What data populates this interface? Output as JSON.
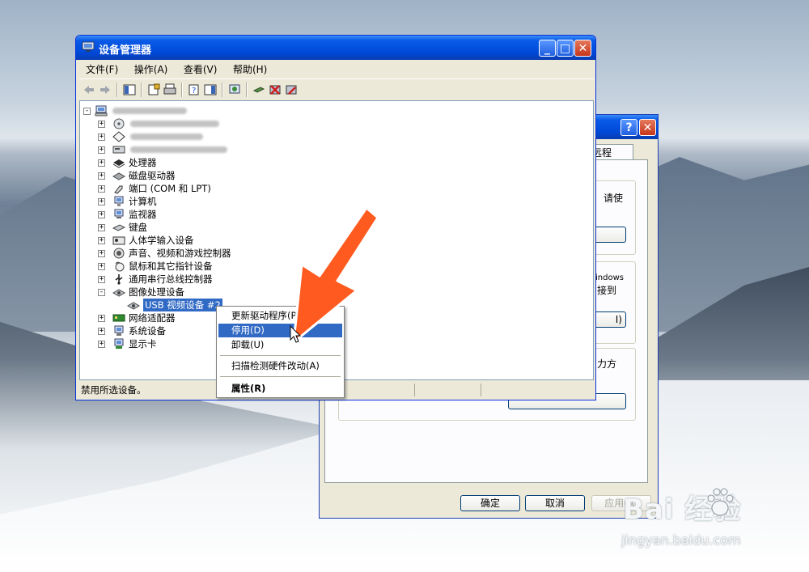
{
  "device_manager": {
    "title": "设备管理器",
    "menu": [
      {
        "label": "文件(F)"
      },
      {
        "label": "操作(A)"
      },
      {
        "label": "查看(V)"
      },
      {
        "label": "帮助(H)"
      }
    ],
    "tree": {
      "categories": [
        {
          "label": "处理器"
        },
        {
          "label": "磁盘驱动器"
        },
        {
          "label": "端口 (COM 和 LPT)"
        },
        {
          "label": "计算机"
        },
        {
          "label": "监视器"
        },
        {
          "label": "键盘"
        },
        {
          "label": "人体学输入设备"
        },
        {
          "label": "声音、视频和游戏控制器"
        },
        {
          "label": "鼠标和其它指针设备"
        },
        {
          "label": "通用串行总线控制器"
        },
        {
          "label": "图像处理设备"
        }
      ],
      "selected_device": "USB 视频设备 #2",
      "after": [
        {
          "label": "网络适配器"
        },
        {
          "label": "系统设备"
        },
        {
          "label": "显示卡"
        }
      ]
    },
    "status_text": "禁用所选设备。"
  },
  "context_menu": {
    "items": [
      {
        "label": "更新驱动程序(P)..."
      },
      {
        "label": "停用(D)",
        "highlighted": true
      },
      {
        "label": "卸载(U)"
      },
      {
        "label": "扫描检测硬件改动(A)"
      },
      {
        "label": "属性(R)",
        "bold": true
      }
    ]
  },
  "properties_dialog": {
    "tab_label": "远程",
    "fragments": {
      "a": "请使",
      "b": "indows",
      "c": "接到",
      "d": "I)",
      "e": "力方"
    },
    "buttons": {
      "ok": "确定",
      "cancel": "取消",
      "apply": "应用(A)"
    }
  },
  "watermark": {
    "brand": "Bai  经验",
    "url": "jingyan.baidu.com"
  },
  "colors": {
    "xp_title_blue": "#0a5be8",
    "selection_blue": "#316ac5",
    "pointer_arrow": "#ff5a1f"
  }
}
